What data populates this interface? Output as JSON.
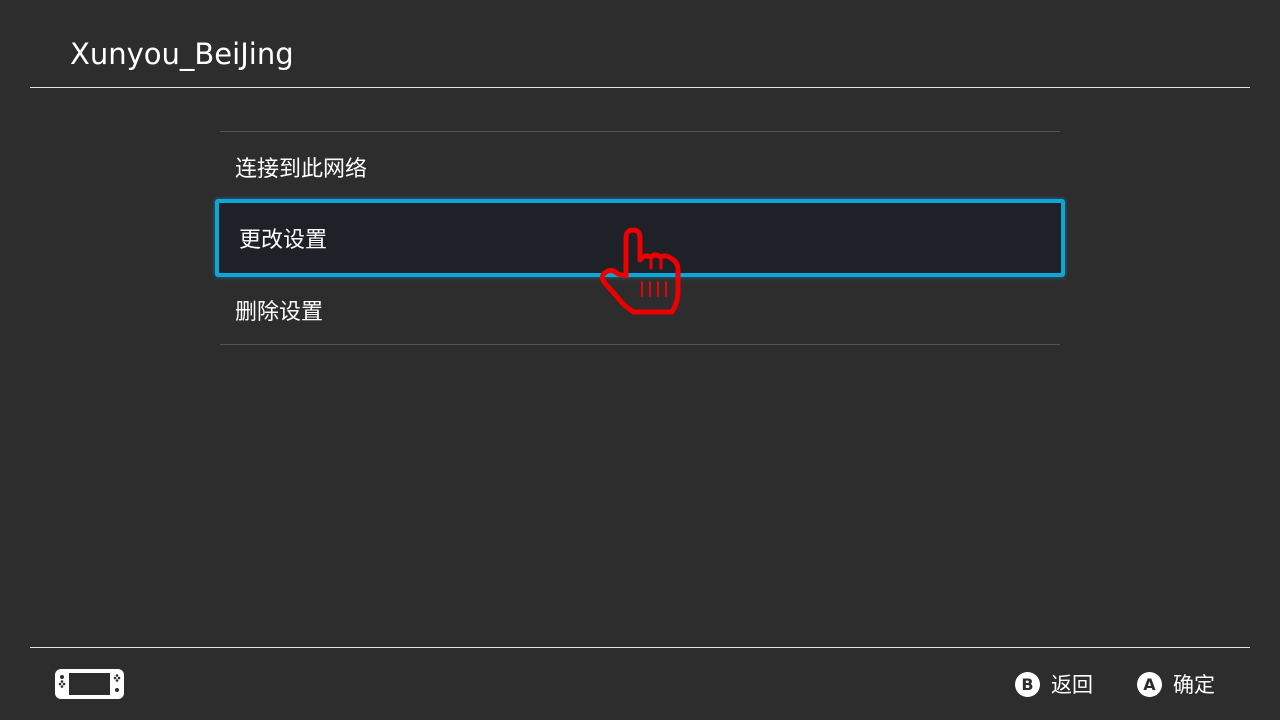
{
  "header": {
    "title": "Xunyou_BeiJing"
  },
  "menu": {
    "items": [
      {
        "label": "连接到此网络",
        "selected": false
      },
      {
        "label": "更改设置",
        "selected": true
      },
      {
        "label": "删除设置",
        "selected": false
      }
    ]
  },
  "footer": {
    "back": {
      "button": "B",
      "label": "返回"
    },
    "confirm": {
      "button": "A",
      "label": "确定"
    }
  },
  "colors": {
    "background": "#2d2d2d",
    "selection_border": "#0ea5d8",
    "selection_fill": "#1f2128",
    "cursor": "#ee0000"
  },
  "icons": {
    "console": "handheld-console-icon",
    "cursor": "pointing-hand-cursor"
  }
}
